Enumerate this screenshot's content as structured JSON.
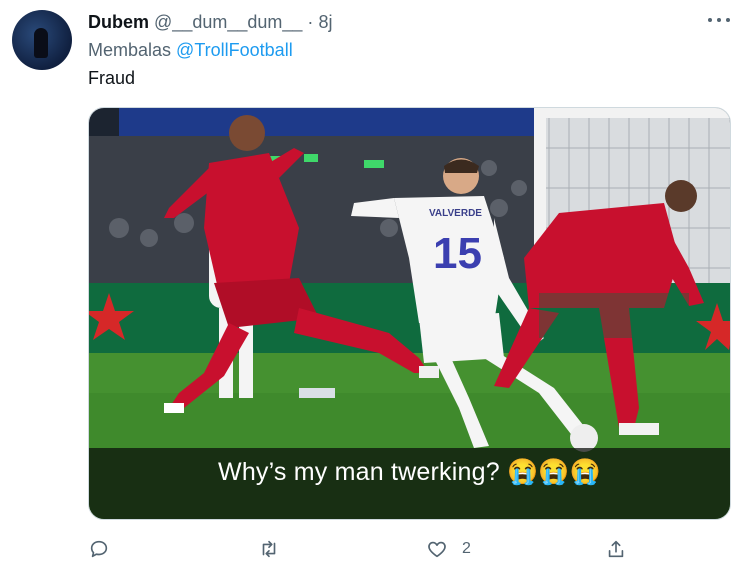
{
  "tweet": {
    "author_name": "Dubem",
    "author_handle": "@__dum__dum__",
    "separator": "·",
    "time": "8j",
    "reply_prefix": "Membalas",
    "reply_to": "@TrollFootball",
    "text": "Fraud"
  },
  "media": {
    "caption": "Why’s my man twerking? 😭😭😭",
    "jersey_name": "VALVERDE",
    "jersey_number": "15"
  },
  "actions": {
    "reply_icon": "reply-icon",
    "retweet_icon": "retweet-icon",
    "like_icon": "heart-icon",
    "like_count": "2",
    "share_icon": "share-icon"
  },
  "colors": {
    "accent": "#1d9bf0",
    "secondary_text": "#536471",
    "primary_text": "#0f1419"
  }
}
